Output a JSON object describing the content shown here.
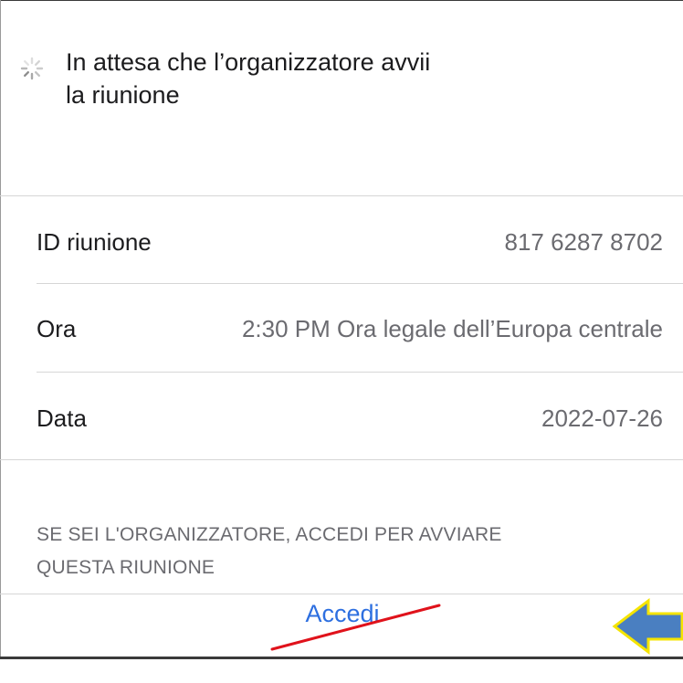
{
  "waiting": {
    "line1": "In attesa che l’organizzatore avvii",
    "line2": "la riunione",
    "icon": "spinner-icon"
  },
  "details": {
    "meeting_id_label": "ID riunione",
    "meeting_id_value": "817 6287 8702",
    "time_label": "Ora",
    "time_value": "2:30 PM Ora legale dell’Europa centrale",
    "date_label": "Data",
    "date_value": "2022-07-26"
  },
  "host_note": {
    "line1": "SE SEI L'ORGANIZZATORE, ACCEDI PER AVVIARE",
    "line2": "QUESTA RIUNIONE"
  },
  "actions": {
    "login_label": "Accedi"
  },
  "colors": {
    "accent": "#2d6fe0",
    "secondary_text": "#6b6b70",
    "annotation_line": "#e0121b",
    "annotation_arrow_fill": "#4a7fc1",
    "annotation_arrow_outline": "#f5e400"
  },
  "annotations": {
    "strike_icon": "red-strike-line",
    "pointer_icon": "left-arrow-icon"
  }
}
